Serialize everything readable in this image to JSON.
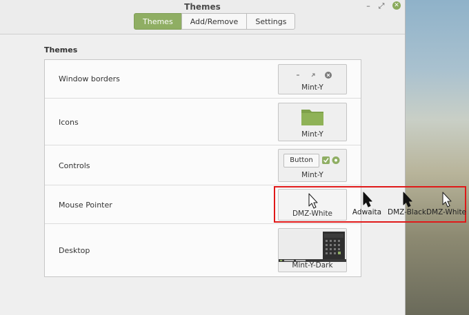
{
  "window": {
    "title": "Themes",
    "controls": {
      "minimize": "–",
      "maximize": "⤢",
      "close": "✕"
    }
  },
  "tabs": [
    {
      "label": "Themes",
      "active": true
    },
    {
      "label": "Add/Remove",
      "active": false
    },
    {
      "label": "Settings",
      "active": false
    }
  ],
  "section": {
    "heading": "Themes"
  },
  "rows": [
    {
      "label": "Window borders",
      "preview_caption": "Mint-Y"
    },
    {
      "label": "Icons",
      "preview_caption": "Mint-Y"
    },
    {
      "label": "Controls",
      "preview_caption": "Mint-Y",
      "button_text": "Button"
    },
    {
      "label": "Mouse Pointer",
      "preview_caption": "DMZ-White"
    },
    {
      "label": "Desktop",
      "preview_caption": "Mint-Y-Dark"
    }
  ],
  "pointer_options": [
    "Adwaita",
    "DMZ-Black",
    "DMZ-White"
  ],
  "colors": {
    "accent": "#8fae63",
    "highlight": "#e01818",
    "folder": "#7fa14a"
  },
  "icons": [
    "minimize-icon",
    "maximize-icon",
    "close-icon",
    "folder-icon",
    "checkbox-icon",
    "radio-icon",
    "cursor-icon"
  ]
}
